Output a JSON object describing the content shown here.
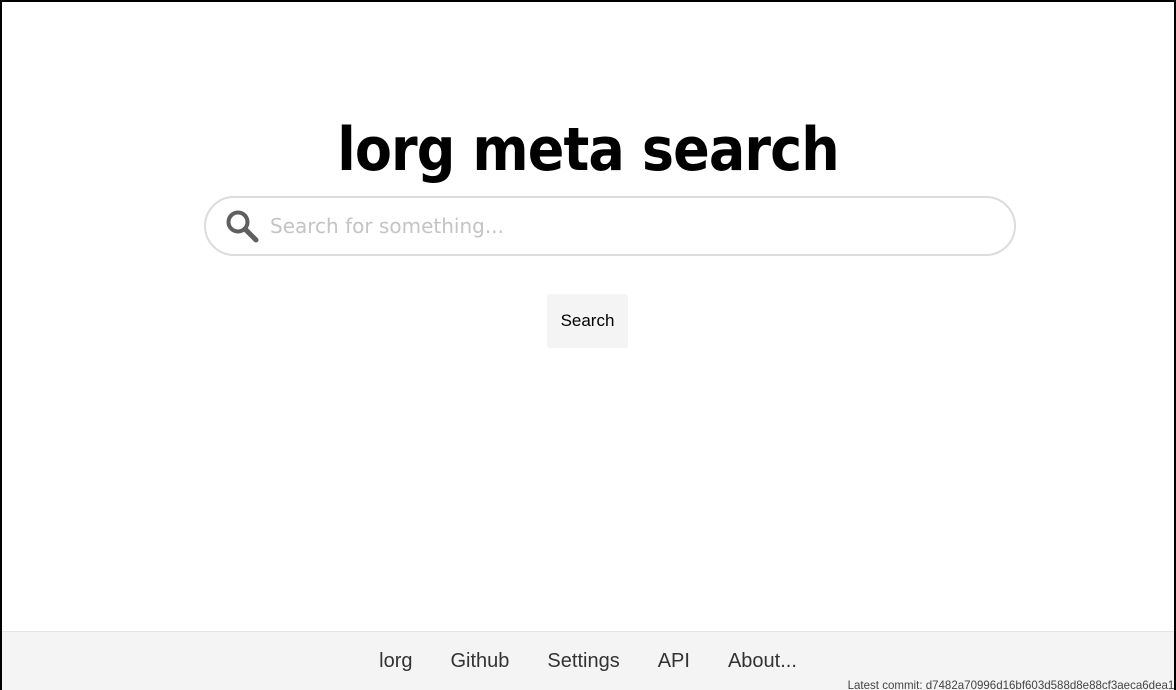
{
  "header": {
    "title": "lorg meta search"
  },
  "search": {
    "placeholder": "Search for something...",
    "value": "",
    "button_label": "Search",
    "icon": "search-icon"
  },
  "footer": {
    "links": [
      "lorg",
      "Github",
      "Settings",
      "API",
      "About..."
    ],
    "commit_text": "Latest commit: d7482a70996d16bf603d588d8e88cf3aeca6dea1"
  },
  "colors": {
    "page_background": "#ffffff",
    "footer_background": "#f4f4f4",
    "search_border": "#dcdcdc",
    "button_background": "#f4f4f4"
  }
}
